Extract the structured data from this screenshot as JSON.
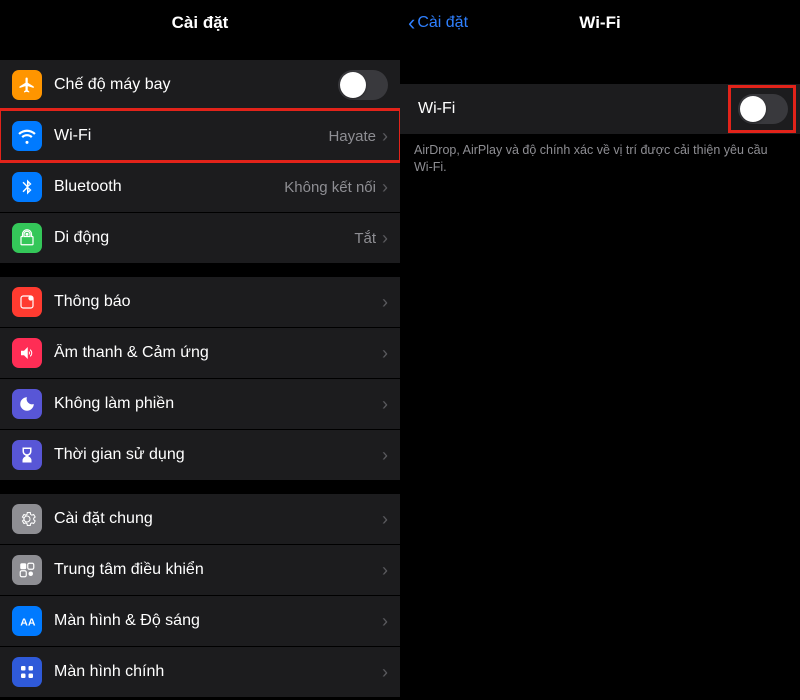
{
  "left": {
    "title": "Cài đặt",
    "groups": [
      {
        "rows": [
          {
            "key": "airplane",
            "label": "Chế độ máy bay",
            "type": "toggle",
            "state": "off"
          },
          {
            "key": "wifi",
            "label": "Wi-Fi",
            "value": "Hayate",
            "type": "nav",
            "highlight": true
          },
          {
            "key": "bluetooth",
            "label": "Bluetooth",
            "value": "Không kết nối",
            "type": "nav"
          },
          {
            "key": "cellular",
            "label": "Di động",
            "value": "Tắt",
            "type": "nav"
          }
        ]
      },
      {
        "rows": [
          {
            "key": "notifications",
            "label": "Thông báo",
            "type": "nav"
          },
          {
            "key": "sounds",
            "label": "Âm thanh & Cảm ứng",
            "type": "nav"
          },
          {
            "key": "dnd",
            "label": "Không làm phiền",
            "type": "nav"
          },
          {
            "key": "screentime",
            "label": "Thời gian sử dụng",
            "type": "nav"
          }
        ]
      },
      {
        "rows": [
          {
            "key": "general",
            "label": "Cài đặt chung",
            "type": "nav"
          },
          {
            "key": "controlcenter",
            "label": "Trung tâm điều khiển",
            "type": "nav"
          },
          {
            "key": "display",
            "label": "Màn hình & Độ sáng",
            "type": "nav"
          },
          {
            "key": "home",
            "label": "Màn hình chính",
            "type": "nav"
          }
        ]
      }
    ]
  },
  "right": {
    "back": "Cài đặt",
    "title": "Wi-Fi",
    "row_label": "Wi-Fi",
    "toggle_state": "off",
    "note": "AirDrop, AirPlay và độ chính xác về vị trí được cải thiện yêu cầu Wi-Fi."
  }
}
